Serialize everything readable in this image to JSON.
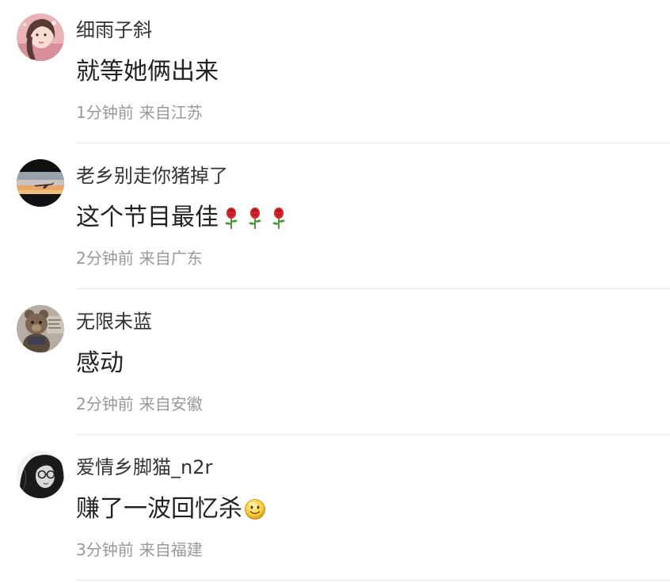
{
  "comments": [
    {
      "username": "细雨子斜",
      "content": "就等她俩出来",
      "time": "1分钟前",
      "location": "来自江苏",
      "avatar": "avatar-pink-portrait",
      "emojis": []
    },
    {
      "username": "老乡别走你猪掉了",
      "content": "这个节目最佳",
      "time": "2分钟前",
      "location": "来自广东",
      "avatar": "avatar-airplane-sunset",
      "emojis": [
        "rose-icon",
        "rose-icon",
        "rose-icon"
      ]
    },
    {
      "username": "无限未蓝",
      "content": "感动",
      "time": "2分钟前",
      "location": "来自安徽",
      "avatar": "avatar-teddy-bear",
      "emojis": []
    },
    {
      "username": "爱情乡脚猫_n2r",
      "content": "赚了一波回忆杀",
      "time": "3分钟前",
      "location": "来自福建",
      "avatar": "avatar-bw-portrait",
      "emojis": [
        "smile-icon"
      ]
    }
  ]
}
